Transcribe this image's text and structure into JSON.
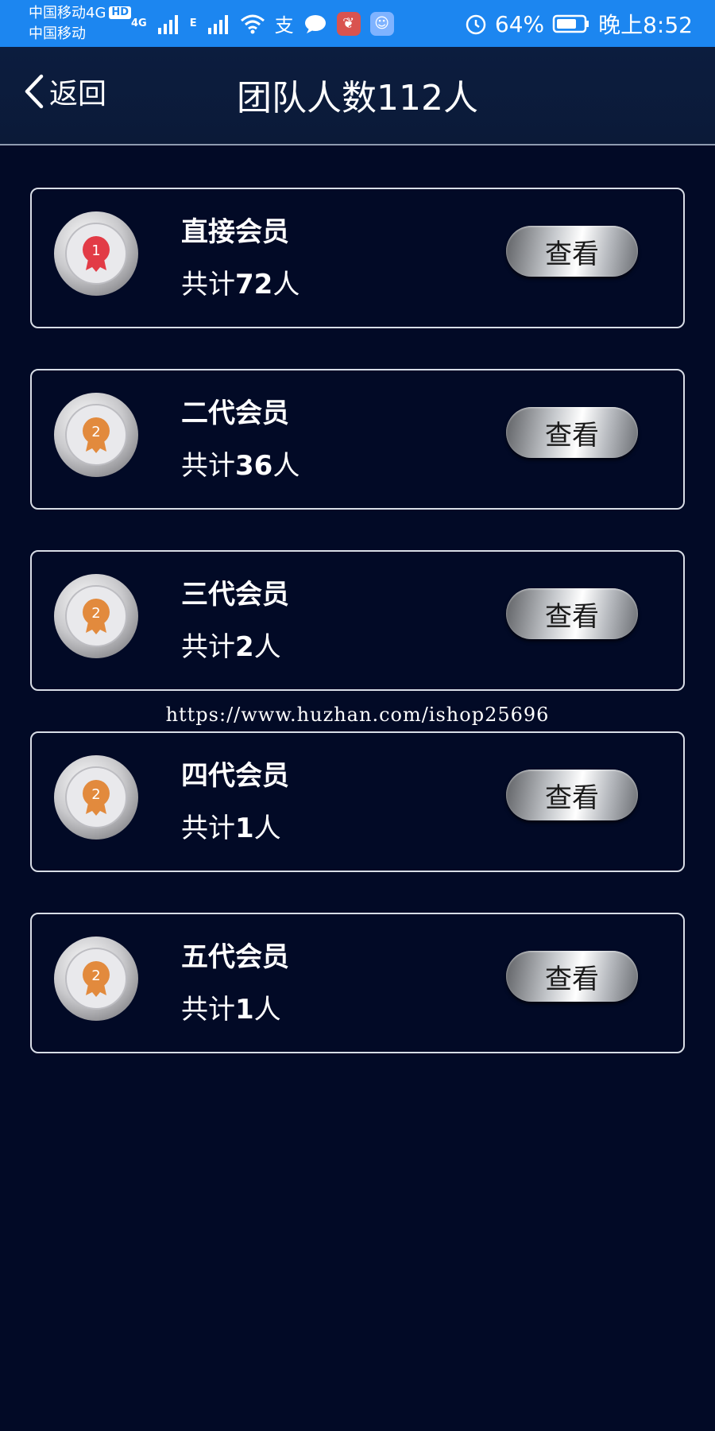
{
  "status_bar": {
    "carrier_line1": "中国移动4G",
    "hd": "HD",
    "carrier_line2": "中国移动",
    "net_4g": "4G",
    "net_e": "E",
    "battery_percent": "64%",
    "time": "晚上8:52",
    "icons": [
      "signal-icon",
      "wifi-icon",
      "alipay-icon",
      "message-icon",
      "app-icon",
      "app-icon",
      "alarm-icon",
      "battery-icon"
    ]
  },
  "header": {
    "back_label": "返回",
    "title": "团队人数112人"
  },
  "members": [
    {
      "title": "直接会员",
      "count_prefix": "共计",
      "count": "72",
      "count_suffix": "人",
      "medal_number": "1",
      "medal_color": "#e23b46",
      "button": "查看"
    },
    {
      "title": "二代会员",
      "count_prefix": "共计",
      "count": "36",
      "count_suffix": "人",
      "medal_number": "2",
      "medal_color": "#e28a3d",
      "button": "查看"
    },
    {
      "title": "三代会员",
      "count_prefix": "共计",
      "count": "2",
      "count_suffix": "人",
      "medal_number": "2",
      "medal_color": "#e28a3d",
      "button": "查看"
    },
    {
      "title": "四代会员",
      "count_prefix": "共计",
      "count": "1",
      "count_suffix": "人",
      "medal_number": "2",
      "medal_color": "#e28a3d",
      "button": "查看"
    },
    {
      "title": "五代会员",
      "count_prefix": "共计",
      "count": "1",
      "count_suffix": "人",
      "medal_number": "2",
      "medal_color": "#e28a3d",
      "button": "查看"
    }
  ],
  "watermark": "https://www.huzhan.com/ishop25696",
  "colors": {
    "status_bar": "#1c86f0",
    "background": "#020a26",
    "header": "#0c1d3f",
    "card_border": "#d8dde6"
  }
}
